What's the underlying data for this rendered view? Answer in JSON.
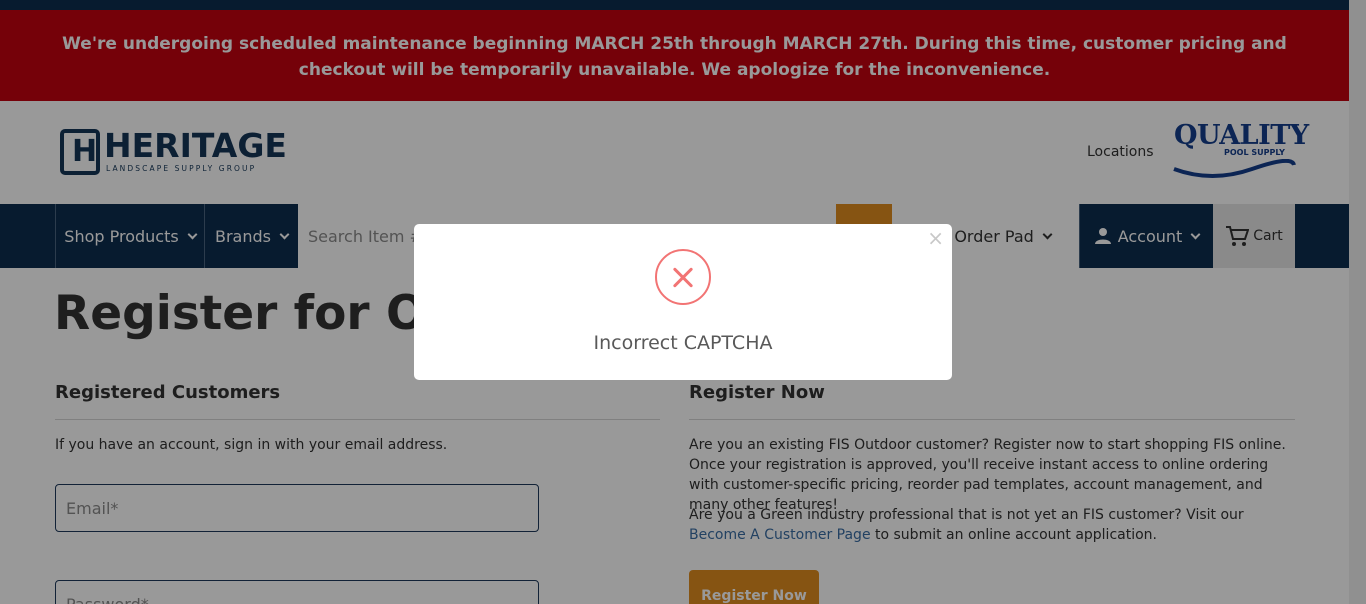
{
  "banner": {
    "text": "We're undergoing scheduled maintenance beginning MARCH 25th through MARCH 27th. During this time, customer pricing and checkout will be temporarily unavailable. We apologize for the inconvenience."
  },
  "header": {
    "logo_mark": "H",
    "logo_word": "HERITAGE",
    "logo_sub": "LANDSCAPE SUPPLY GROUP",
    "locations_label": "Locations",
    "partner_word": "QUALITY",
    "partner_sub": "POOL SUPPLY"
  },
  "nav": {
    "shop_products": "Shop Products",
    "brands": "Brands",
    "search_placeholder": "Search Item #,",
    "quick_order": "Quick Order Pad",
    "account": "Account",
    "cart": "Cart"
  },
  "page": {
    "title": "Register for Online",
    "registered": {
      "heading": "Registered Customers",
      "intro": "If you have an account, sign in with your email address.",
      "email_placeholder": "Email*",
      "password_placeholder": "Password*"
    },
    "register": {
      "heading": "Register Now",
      "para1": "Are you an existing FIS Outdoor customer? Register now to start shopping FIS online. Once your registration is approved, you'll receive instant access to online ordering with customer-specific pricing, reorder pad templates, account management, and many other features!",
      "para2_before": "Are you a Green industry professional that is not yet an FIS customer? Visit our ",
      "para2_link": "Become A Customer Page",
      "para2_after": " to submit an online account application.",
      "button": "Register Now"
    }
  },
  "modal": {
    "close": "×",
    "message": "Incorrect CAPTCHA"
  },
  "colors": {
    "banner_red": "#c4020f",
    "navy": "#0d2d4f",
    "accent_orange": "#e08d1f",
    "error_red": "#f27474"
  },
  "icons": {
    "search": "search-icon",
    "account": "user-icon",
    "cart": "cart-icon",
    "error": "error-x-icon",
    "close": "close-icon"
  }
}
